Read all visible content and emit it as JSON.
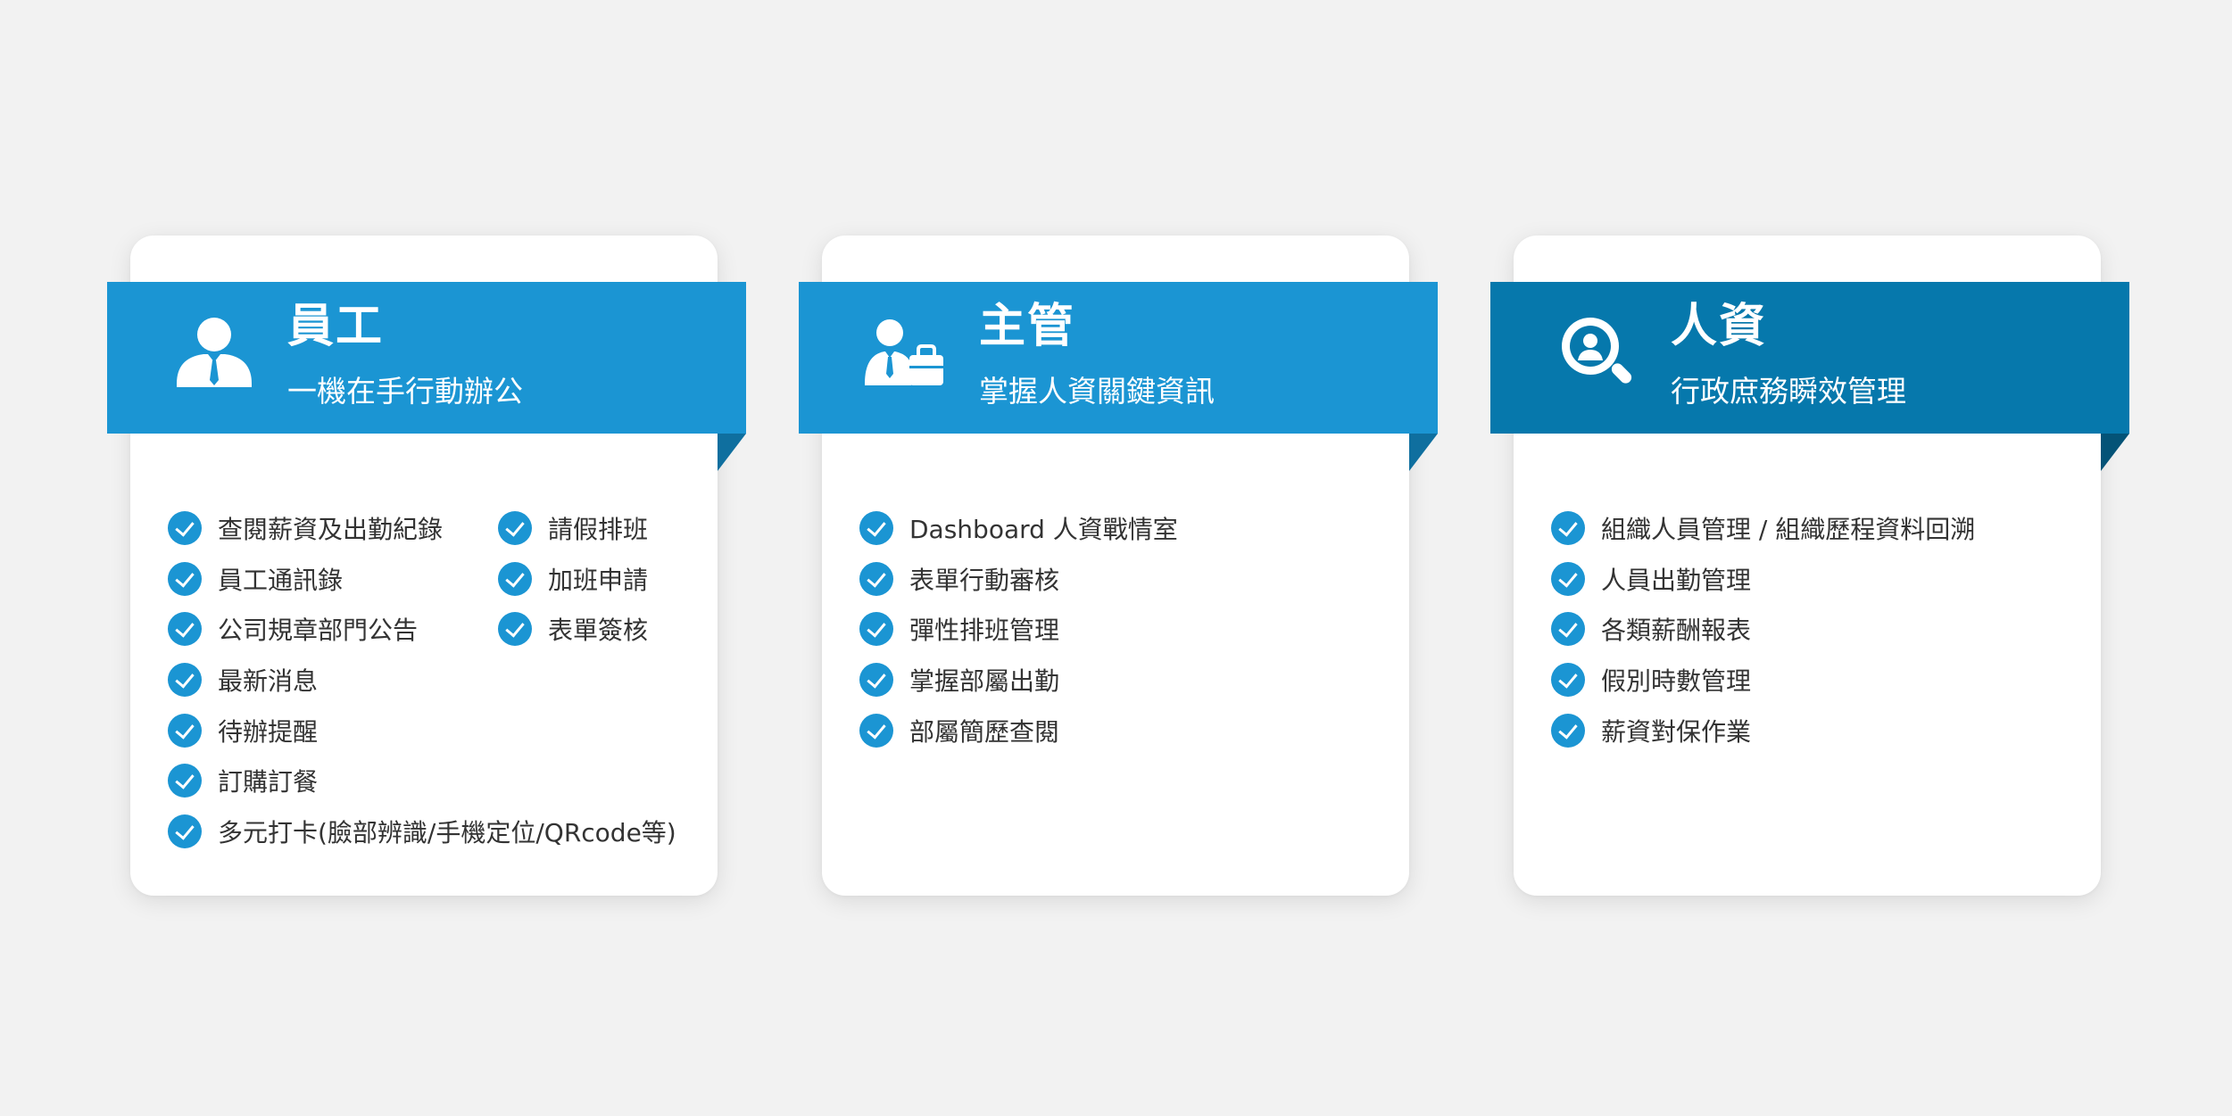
{
  "colors": {
    "page_background": "#f2f2f2",
    "card_background": "#ffffff",
    "ribbon_light_blue": "#1b95d3",
    "ribbon_dark_blue": "#0678ac",
    "fold_light_blue": "#0f6f9f",
    "fold_dark_blue": "#045377",
    "check_blue": "#1b95d3",
    "item_text": "#333333"
  },
  "cards": [
    {
      "id": "employee",
      "icon": "employee-person-icon",
      "title": "員工",
      "subtitle": "一機在手行動辦公",
      "items_left": [
        "查閱薪資及出勤紀錄",
        "員工通訊錄",
        "公司規章部門公告",
        "最新消息",
        "待辦提醒",
        "訂購訂餐",
        "多元打卡(臉部辨識/手機定位/QRcode等)"
      ],
      "items_right": [
        "請假排班",
        "加班申請",
        "表單簽核"
      ]
    },
    {
      "id": "manager",
      "icon": "manager-briefcase-icon",
      "title": "主管",
      "subtitle": "掌握人資關鍵資訊",
      "items_left": [
        "Dashboard 人資戰情室",
        "表單行動審核",
        "彈性排班管理",
        "掌握部屬出勤",
        "部屬簡歷查閱"
      ]
    },
    {
      "id": "hr",
      "icon": "hr-search-person-icon",
      "title": "人資",
      "subtitle": "行政庶務瞬效管理",
      "items_left": [
        "組織人員管理 / 組織歷程資料回溯",
        "人員出勤管理",
        "各類薪酬報表",
        "假別時數管理",
        "薪資對保作業"
      ]
    }
  ]
}
